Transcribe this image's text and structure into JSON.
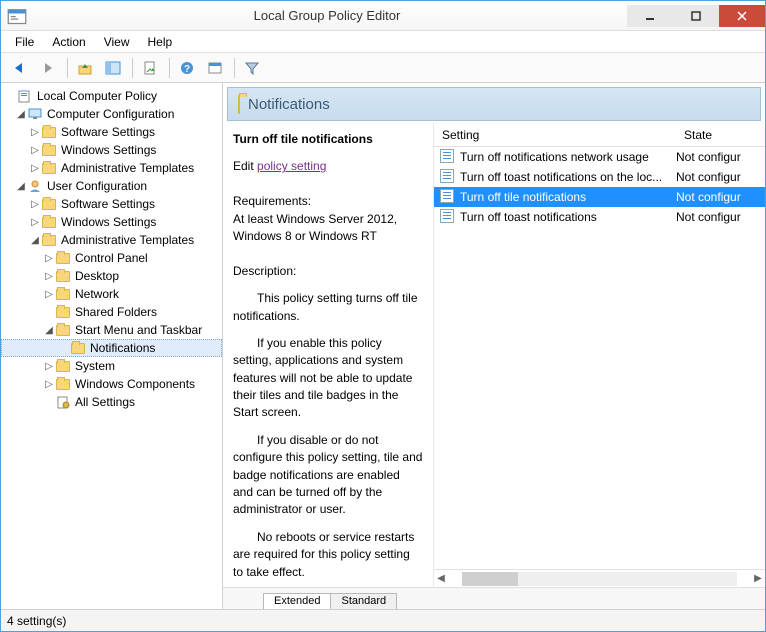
{
  "window": {
    "title": "Local Group Policy Editor"
  },
  "menu": {
    "file": "File",
    "action": "Action",
    "view": "View",
    "help": "Help"
  },
  "tree": {
    "root": "Local Computer Policy",
    "cc": "Computer Configuration",
    "cc_software": "Software Settings",
    "cc_windows": "Windows Settings",
    "cc_admin": "Administrative Templates",
    "uc": "User Configuration",
    "uc_software": "Software Settings",
    "uc_windows": "Windows Settings",
    "uc_admin": "Administrative Templates",
    "cp": "Control Panel",
    "desktop": "Desktop",
    "network": "Network",
    "shared": "Shared Folders",
    "smt": "Start Menu and Taskbar",
    "notifications": "Notifications",
    "system": "System",
    "wincomp": "Windows Components",
    "allset": "All Settings"
  },
  "header": {
    "title": "Notifications"
  },
  "description": {
    "title": "Turn off tile notifications",
    "edit_prefix": "Edit ",
    "edit_link": "policy setting ",
    "req_label": "Requirements:",
    "req_text": "At least Windows Server 2012, Windows 8 or Windows RT",
    "desc_label": "Description:",
    "p1": "This policy setting turns off tile notifications.",
    "p2": "If you enable this policy setting, applications and system features will not be able to update their tiles and tile badges in the Start screen.",
    "p3": "If you disable or do not configure this policy setting, tile and badge notifications are enabled and can be turned off by the administrator or user.",
    "p4": "No reboots or service restarts are required for this policy setting to take effect."
  },
  "list": {
    "col_setting": "Setting",
    "col_state": "State",
    "rows": [
      {
        "text": "Turn off notifications network usage",
        "state": "Not configur"
      },
      {
        "text": "Turn off toast notifications on the loc...",
        "state": "Not configur"
      },
      {
        "text": "Turn off tile notifications",
        "state": "Not configur"
      },
      {
        "text": "Turn off toast notifications",
        "state": "Not configur"
      }
    ],
    "selected_index": 2
  },
  "tabs": {
    "extended": "Extended",
    "standard": "Standard"
  },
  "status": {
    "text": "4 setting(s)"
  }
}
